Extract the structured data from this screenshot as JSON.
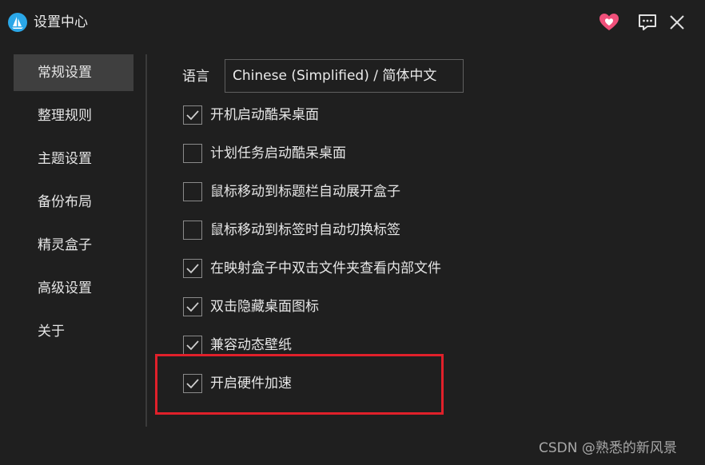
{
  "window": {
    "title": "设置中心",
    "colors": {
      "background": "#1f1f1f",
      "accent": "#2aa7e8",
      "heart": "#f0507a",
      "highlight": "#e0202a"
    },
    "icons": {
      "logo": "sailboat-logo-icon",
      "heart": "heart-icon",
      "feedback": "chat-bubble-icon",
      "close": "close-icon"
    }
  },
  "sidebar": {
    "items": [
      {
        "label": "常规设置",
        "active": true
      },
      {
        "label": "整理规则",
        "active": false
      },
      {
        "label": "主题设置",
        "active": false
      },
      {
        "label": "备份布局",
        "active": false
      },
      {
        "label": "精灵盒子",
        "active": false
      },
      {
        "label": "高级设置",
        "active": false
      },
      {
        "label": "关于",
        "active": false
      }
    ]
  },
  "general": {
    "language_label": "语言",
    "language_value": "Chinese (Simplified) / 简体中文",
    "options": [
      {
        "label": "开机启动酷呆桌面",
        "checked": true
      },
      {
        "label": "计划任务启动酷呆桌面",
        "checked": false
      },
      {
        "label": "鼠标移动到标题栏自动展开盒子",
        "checked": false
      },
      {
        "label": "鼠标移动到标签时自动切换标签",
        "checked": false
      },
      {
        "label": "在映射盒子中双击文件夹查看内部文件",
        "checked": true
      },
      {
        "label": "双击隐藏桌面图标",
        "checked": true
      },
      {
        "label": "兼容动态壁纸",
        "checked": true
      },
      {
        "label": "开启硬件加速",
        "checked": true
      }
    ]
  },
  "watermark": "CSDN @熟悉的新风景"
}
